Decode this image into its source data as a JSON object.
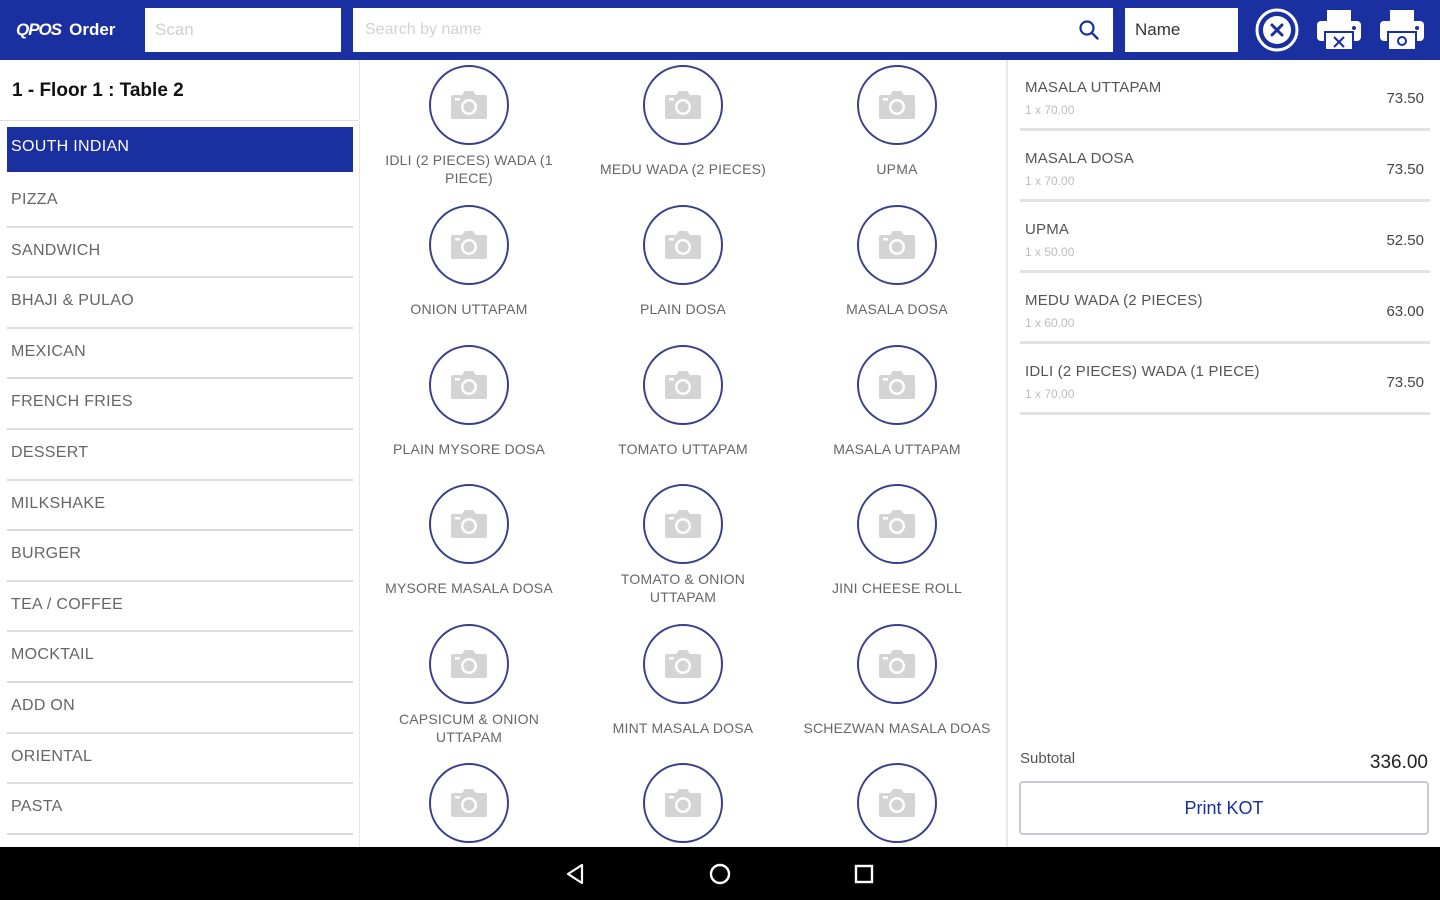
{
  "colors": {
    "primary": "#1a2fa0",
    "circle_border": "#3a3f8c"
  },
  "header": {
    "logo_mark": "QPOS",
    "logo_text": "Order",
    "scan_placeholder": "Scan",
    "search_placeholder": "Search by name",
    "search_icon": "search-icon",
    "filter_value": "Name",
    "actions": [
      "close-circle-icon",
      "printer-icon",
      "printer-camera-icon"
    ]
  },
  "left": {
    "table_title": "1 - Floor 1 : Table 2",
    "categories": [
      {
        "label": "SOUTH INDIAN",
        "active": true
      },
      {
        "label": "PIZZA"
      },
      {
        "label": "SANDWICH"
      },
      {
        "label": "BHAJI & PULAO"
      },
      {
        "label": "MEXICAN"
      },
      {
        "label": "FRENCH FRIES"
      },
      {
        "label": "DESSERT"
      },
      {
        "label": "MILKSHAKE"
      },
      {
        "label": "BURGER"
      },
      {
        "label": "TEA / COFFEE"
      },
      {
        "label": "MOCKTAIL"
      },
      {
        "label": "ADD ON"
      },
      {
        "label": "ORIENTAL"
      },
      {
        "label": "PASTA"
      }
    ]
  },
  "products": [
    {
      "name": "IDLI (2 PIECES) WADA (1 PIECE)"
    },
    {
      "name": "MEDU WADA (2 PIECES)"
    },
    {
      "name": "UPMA"
    },
    {
      "name": "ONION UTTAPAM"
    },
    {
      "name": "PLAIN DOSA"
    },
    {
      "name": "MASALA DOSA"
    },
    {
      "name": "PLAIN MYSORE DOSA"
    },
    {
      "name": "TOMATO UTTAPAM"
    },
    {
      "name": "MASALA UTTAPAM"
    },
    {
      "name": "MYSORE MASALA DOSA"
    },
    {
      "name": "TOMATO & ONION UTTAPAM"
    },
    {
      "name": "JINI CHEESE ROLL"
    },
    {
      "name": "CAPSICUM & ONION UTTAPAM"
    },
    {
      "name": "MINT MASALA DOSA"
    },
    {
      "name": "SCHEZWAN MASALA DOAS"
    },
    {
      "name": ""
    },
    {
      "name": ""
    },
    {
      "name": ""
    }
  ],
  "order": {
    "items": [
      {
        "name": "MASALA UTTAPAM",
        "qty": "1 x 70.00",
        "price": "73.50"
      },
      {
        "name": "MASALA DOSA",
        "qty": "1 x 70.00",
        "price": "73.50"
      },
      {
        "name": "UPMA",
        "qty": "1 x 50.00",
        "price": "52.50"
      },
      {
        "name": "MEDU WADA (2 PIECES)",
        "qty": "1 x 60.00",
        "price": "63.00"
      },
      {
        "name": "IDLI (2 PIECES) WADA (1 PIECE)",
        "qty": "1 x 70.00",
        "price": "73.50"
      }
    ],
    "subtotal_label": "Subtotal",
    "subtotal_value": "336.00",
    "kot_button": "Print KOT"
  },
  "navbar": {
    "back": "back-triangle-icon",
    "home": "home-circle-icon",
    "recent": "recent-apps-square-icon"
  }
}
